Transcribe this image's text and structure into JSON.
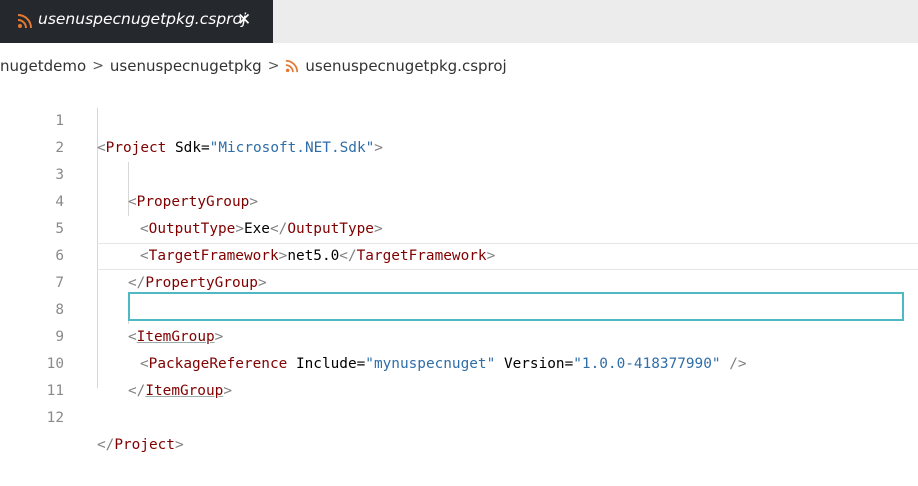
{
  "tab": {
    "label": "usenuspecnugetpkg.csproj",
    "close": "✕",
    "icon": "rss-icon"
  },
  "breadcrumb": {
    "segments": [
      "nugetdemo",
      "usenuspecnugetpkg",
      "usenuspecnugetpkg.csproj"
    ],
    "separator": ">"
  },
  "colors": {
    "tab_bg": "#25292d",
    "icon_orange": "#e37933",
    "tag": "#800000",
    "attribute_value": "#2f6ea8",
    "highlight_border": "#4fb9c3"
  },
  "editor": {
    "lines": [
      {
        "number": "1",
        "open": "<",
        "tag": "Project",
        "attr": "Sdk",
        "eq": "=",
        "value": "\"Microsoft.NET.Sdk\"",
        "close": ">"
      },
      {
        "number": "2"
      },
      {
        "number": "3",
        "open": "<",
        "tag": "PropertyGroup",
        "close": ">"
      },
      {
        "number": "4",
        "open": "<",
        "tag": "OutputType",
        "close": ">",
        "text": "Exe",
        "endopen": "</",
        "endtag": "OutputType",
        "endclose": ">"
      },
      {
        "number": "5",
        "open": "<",
        "tag": "TargetFramework",
        "close": ">",
        "text": "net5.0",
        "endopen": "</",
        "endtag": "TargetFramework",
        "endclose": ">"
      },
      {
        "number": "6",
        "open": "</",
        "tag": "PropertyGroup",
        "close": ">"
      },
      {
        "number": "7"
      },
      {
        "number": "8",
        "open": "<",
        "tag": "ItemGroup",
        "close": ">"
      },
      {
        "number": "9",
        "open": "<",
        "tag": "PackageReference",
        "attr1": "Include",
        "eq": "=",
        "value1": "\"mynuspecnuget\"",
        "attr2": "Version",
        "value2": "\"1.0.0-418377990\"",
        "close": "/>"
      },
      {
        "number": "10",
        "open": "</",
        "tag": "ItemGroup",
        "close": ">"
      },
      {
        "number": "11"
      },
      {
        "number": "12",
        "open": "</",
        "tag": "Project",
        "close": ">"
      }
    ]
  }
}
